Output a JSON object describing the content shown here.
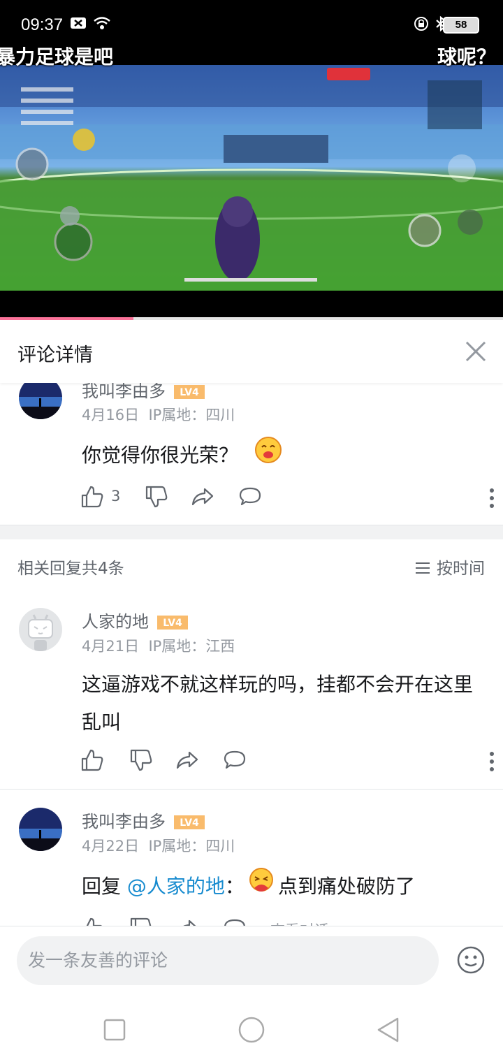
{
  "status_bar": {
    "time": "09:37",
    "battery": "58"
  },
  "video": {
    "danmaku_left": "暴力足球是吧",
    "danmaku_right": "球呢？",
    "progress": 0.265
  },
  "panel": {
    "title": "评论详情"
  },
  "root_comment": {
    "username": "我叫李由多",
    "level": "LV4",
    "date": "4月16日",
    "ip": "IP属地：四川",
    "text": "你觉得你很光荣？",
    "likes": "3"
  },
  "replies_header": {
    "count_text": "相关回复共4条",
    "sort_label": "按时间"
  },
  "replies": [
    {
      "username": "人家的地",
      "level": "LV4",
      "date": "4月21日",
      "ip": "IP属地：江西",
      "text": "这逼游戏不就这样玩的吗，挂都不会开在这里乱叫"
    },
    {
      "username": "我叫李由多",
      "level": "LV4",
      "date": "4月22日",
      "ip": "IP属地：四川",
      "reply_prefix": "回复 ",
      "mention": "@人家的地",
      "colon": "：",
      "text": "点到痛处破防了",
      "view_conversation": "查看对话"
    }
  ],
  "input": {
    "placeholder": "发一条友善的评论"
  },
  "colors": {
    "accent": "#fb7299",
    "level_badge": "#f8b45c",
    "mention": "#178bcf",
    "text_secondary": "#61666d",
    "text_meta": "#9499a0"
  },
  "icons": [
    "wifi-icon",
    "bluetooth-icon",
    "lock-icon",
    "close-icon",
    "thumbs-up-icon",
    "thumbs-down-icon",
    "share-icon",
    "reply-icon",
    "more-icon",
    "sort-icon",
    "emoji-icon",
    "nav-recents-icon",
    "nav-home-icon",
    "nav-back-icon"
  ]
}
